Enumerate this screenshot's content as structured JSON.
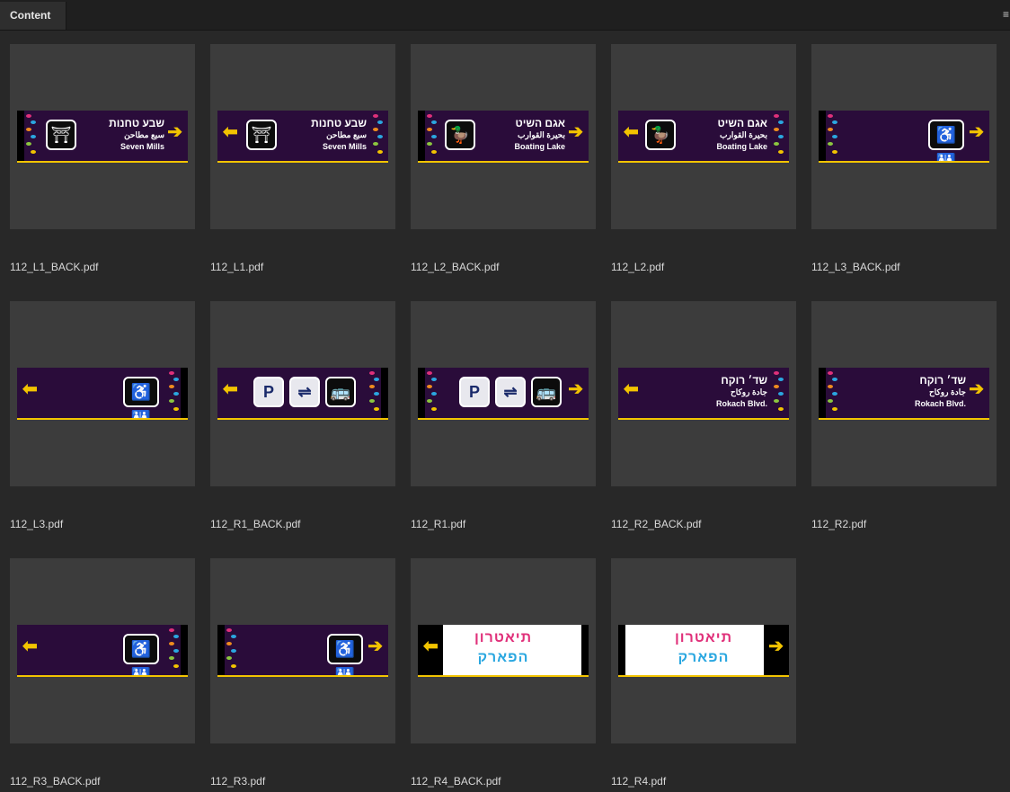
{
  "panel": {
    "tab_label": "Content",
    "menu_icon": "panel-menu-icon"
  },
  "items": [
    {
      "filename": "112_L1_BACK.pdf"
    },
    {
      "filename": "112_L1.pdf"
    },
    {
      "filename": "112_L2_BACK.pdf"
    },
    {
      "filename": "112_L2.pdf"
    },
    {
      "filename": "112_L3_BACK.pdf"
    },
    {
      "filename": "112_L3.pdf"
    },
    {
      "filename": "112_R1_BACK.pdf"
    },
    {
      "filename": "112_R1.pdf"
    },
    {
      "filename": "112_R2_BACK.pdf"
    },
    {
      "filename": "112_R2.pdf"
    },
    {
      "filename": "112_R3_BACK.pdf"
    },
    {
      "filename": "112_R3.pdf"
    },
    {
      "filename": "112_R4_BACK.pdf"
    },
    {
      "filename": "112_R4.pdf"
    }
  ],
  "sign_text": {
    "seven_mills": {
      "he": "שבע טחנות",
      "ar": "سبع مطاحن",
      "en": "Seven Mills"
    },
    "boating_lake": {
      "he": "אגם השיט",
      "ar": "بحيرة القوارب",
      "en": "Boating Lake"
    },
    "rokach": {
      "he": "שד׳ רוקח",
      "ar": "جادة روكاح",
      "en": "Rokach Blvd."
    },
    "theatre_logo": {
      "line1": "תיאטרון",
      "line2": "הפארק"
    }
  },
  "colors": {
    "sign_bg": "#2a0c3a",
    "accent_yellow": "#f2c400",
    "thumb_bg": "#3c3c3c"
  }
}
